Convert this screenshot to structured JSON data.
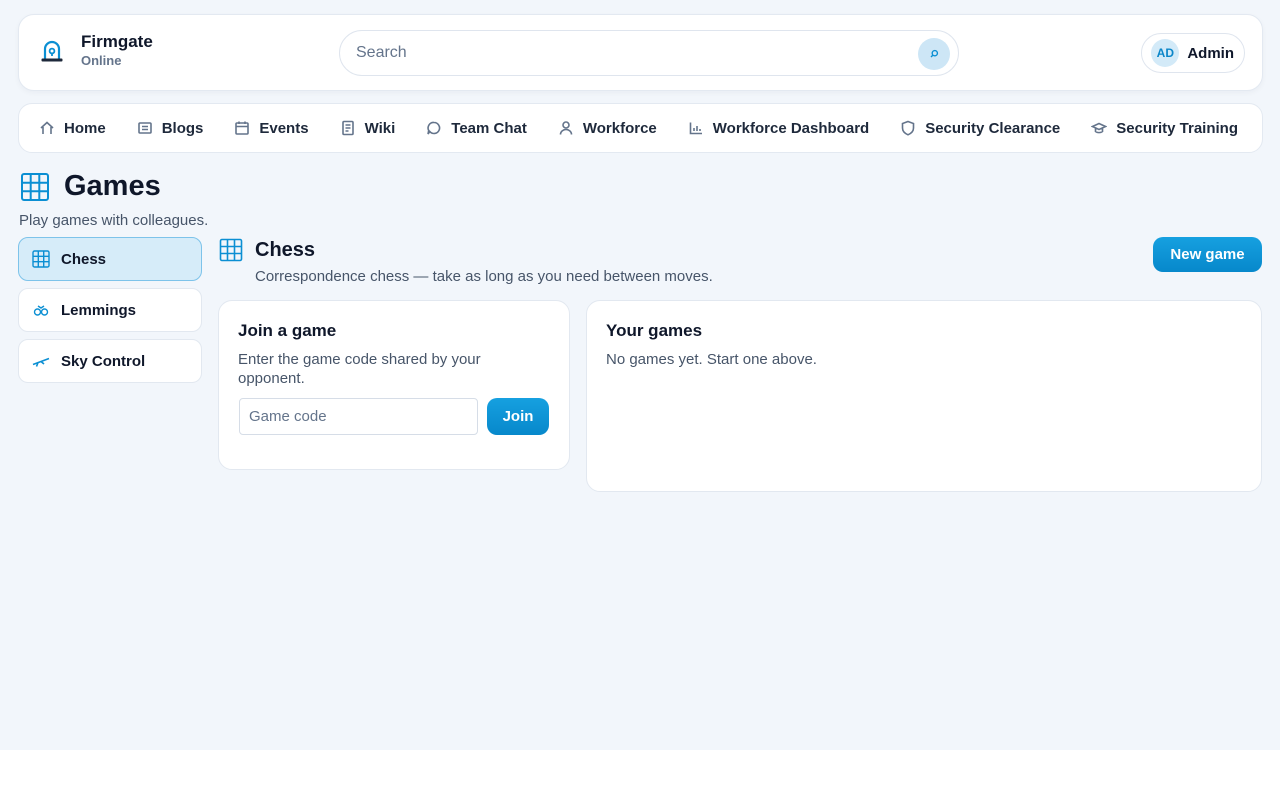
{
  "brand": {
    "name": "Firmgate",
    "status": "Online"
  },
  "search": {
    "placeholder": "Search"
  },
  "user": {
    "initials": "AD",
    "name": "Admin"
  },
  "nav": {
    "items": [
      {
        "label": "Home",
        "icon": "home-icon"
      },
      {
        "label": "Blogs",
        "icon": "blog-icon"
      },
      {
        "label": "Events",
        "icon": "calendar-icon"
      },
      {
        "label": "Wiki",
        "icon": "book-icon"
      },
      {
        "label": "Team Chat",
        "icon": "chat-icon"
      },
      {
        "label": "Workforce",
        "icon": "person-icon"
      },
      {
        "label": "Workforce Dashboard",
        "icon": "bar-chart-icon"
      },
      {
        "label": "Security Clearance",
        "icon": "shield-icon"
      },
      {
        "label": "Security Training",
        "icon": "graduation-cap-icon"
      }
    ]
  },
  "page": {
    "title": "Games",
    "subtitle": "Play games with colleagues."
  },
  "games": [
    {
      "label": "Chess",
      "icon": "chess-board-icon",
      "active": true
    },
    {
      "label": "Lemmings",
      "icon": "lemmings-icon",
      "active": false
    },
    {
      "label": "Sky Control",
      "icon": "airplane-icon",
      "active": false
    }
  ],
  "section": {
    "title": "Chess",
    "subtitle": "Correspondence chess — take as long as you need between moves.",
    "new_game_label": "New game"
  },
  "join": {
    "title": "Join a game",
    "description": "Enter the game code shared by your opponent.",
    "input_placeholder": "Game code",
    "button_label": "Join"
  },
  "your_games": {
    "title": "Your games",
    "empty_text": "No games yet. Start one above."
  },
  "colors": {
    "accent": "#0b8fd3",
    "accent_light": "#d6ecf9",
    "background": "#f2f6fb"
  }
}
